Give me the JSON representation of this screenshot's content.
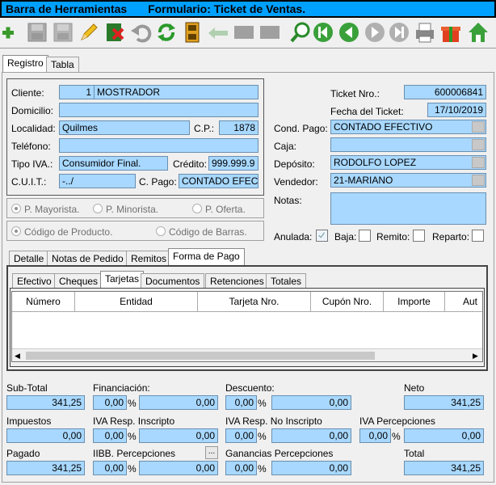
{
  "titlebar": {
    "bar_label": "Barra de Herramientas",
    "form_label": "Formulario: Ticket de Ventas."
  },
  "toolbar": {
    "icons": [
      "add-icon",
      "save-icon",
      "save-disabled-icon",
      "edit-icon",
      "delete-icon",
      "undo-icon",
      "refresh-icon",
      "film-icon",
      "return-icon",
      "grid-disabled-icon",
      "grid-disabled-icon",
      "search-icon",
      "first-icon",
      "prev-icon",
      "next-icon",
      "last-icon",
      "print-icon",
      "gift-icon",
      "home-icon"
    ]
  },
  "main_tabs": [
    "Registro",
    "Tabla"
  ],
  "cliente": {
    "label": "Cliente:",
    "code": "1",
    "name": "MOSTRADOR"
  },
  "domicilio": {
    "label": "Domicilio:",
    "value": ""
  },
  "localidad": {
    "label": "Localidad:",
    "value": "Quilmes",
    "cp_label": "C.P.:",
    "cp": "1878"
  },
  "telefono": {
    "label": "Teléfono:",
    "value": ""
  },
  "tipo_iva": {
    "label": "Tipo IVA.:",
    "value": "Consumidor Final.",
    "credito_label": "Crédito:",
    "credito": "999.999.9"
  },
  "cuit": {
    "label": "C.U.I.T.:",
    "value": "-../",
    "cpago_label": "C. Pago:",
    "cpago": "CONTADO EFEC"
  },
  "price_options": {
    "mayorista": "P. Mayorista.",
    "minorista": "P. Minorista.",
    "oferta": "P. Oferta."
  },
  "code_options": {
    "producto": "Código de Producto.",
    "barras": "Código de Barras."
  },
  "ticket": {
    "label": "Ticket Nro.:",
    "value": "600006841"
  },
  "fecha": {
    "label": "Fecha del Ticket:",
    "value": "17/10/2019"
  },
  "cond_pago": {
    "label": "Cond. Pago:",
    "value": "CONTADO EFECTIVO"
  },
  "caja": {
    "label": "Caja:",
    "value": ""
  },
  "deposito": {
    "label": "Depósito:",
    "value": "RODOLFO LOPEZ"
  },
  "vendedor": {
    "label": "Vendedor:",
    "value": "21-MARIANO"
  },
  "notas": {
    "label": "Notas:",
    "value": ""
  },
  "flags": {
    "anulada": "Anulada:",
    "baja": "Baja:",
    "remito": "Remito:",
    "reparto": "Reparto:"
  },
  "detail_tabs": [
    "Detalle",
    "Notas de Pedido",
    "Remitos",
    "Forma de Pago"
  ],
  "payment_tabs": [
    "Efectivo",
    "Cheques",
    "Tarjetas",
    "Documentos",
    "Retenciones",
    "Totales"
  ],
  "table_headers": [
    "Número",
    "Entidad",
    "Tarjeta Nro.",
    "Cupón Nro.",
    "Importe",
    "Aut"
  ],
  "totals": {
    "subtotal": {
      "label": "Sub-Total",
      "value": "341,25"
    },
    "financiacion": {
      "label": "Financiación:",
      "pct": "0,00",
      "value": "0,00"
    },
    "descuento": {
      "label": "Descuento:",
      "pct": "0,00",
      "value": "0,00"
    },
    "neto": {
      "label": "Neto",
      "value": "341,25"
    },
    "impuestos": {
      "label": "Impuestos",
      "value": "0,00"
    },
    "iva_insc": {
      "label": "IVA Resp. Inscripto",
      "pct": "0,00",
      "value": "0,00"
    },
    "iva_noinsc": {
      "label": "IVA Resp. No Inscripto",
      "pct": "0,00",
      "value": "0,00"
    },
    "iva_perc": {
      "label": "IVA Percepciones",
      "pct": "0,00",
      "value": "0,00"
    },
    "pagado": {
      "label": "Pagado",
      "value": "341,25"
    },
    "iibb": {
      "label": "IIBB. Percepciones",
      "pct": "0,00",
      "value": "0,00",
      "btn": "..."
    },
    "ganancias": {
      "label": "Ganancias Percepciones",
      "pct": "0,00",
      "value": "0,00"
    },
    "total": {
      "label": "Total",
      "value": "341,25"
    },
    "pct_sign": "%"
  }
}
